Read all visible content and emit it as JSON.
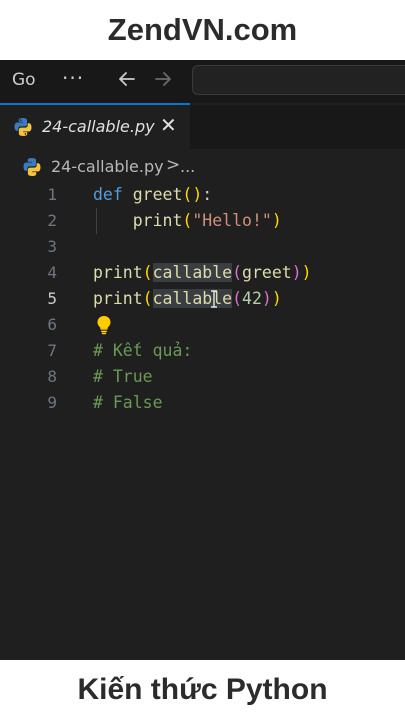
{
  "banner": {
    "top_text": "ZendVN.com",
    "bottom_text": "Kiến thức Python"
  },
  "titlebar": {
    "menu_go": "Go",
    "more": "···",
    "back_icon": "arrow-left-icon",
    "forward_icon": "arrow-right-icon"
  },
  "tab": {
    "label": "24-callable.py",
    "close": "✕",
    "icon": "python-icon"
  },
  "breadcrumb": {
    "file": "24-callable.py",
    "separator": ">",
    "more": "..."
  },
  "editor": {
    "active_line": 5,
    "line_numbers": [
      "1",
      "2",
      "3",
      "4",
      "5",
      "6",
      "7",
      "8",
      "9"
    ],
    "lines": {
      "l1": {
        "kw": "def",
        "fn": "greet",
        "open": "(",
        "close": ")",
        "colon": ":"
      },
      "l2": {
        "fn": "print",
        "open": "(",
        "str": "\"Hello!\"",
        "close": ")"
      },
      "l4": {
        "fn": "print",
        "open": "(",
        "fn2": "callable",
        "open2": "(",
        "arg": "greet",
        "close2": ")",
        "close": ")"
      },
      "l5": {
        "fn": "print",
        "open": "(",
        "fn2": "callable",
        "open2": "(",
        "num": "42",
        "close2": ")",
        "close": ")"
      },
      "l7": "# Kết quả:",
      "l8": "# True",
      "l9": "# False"
    }
  },
  "colors": {
    "background": "#1f1f1f",
    "keyword": "#569cd6",
    "function": "#dcdcaa",
    "string": "#ce9178",
    "number": "#b5cea8",
    "comment": "#6a9955",
    "bracket_1": "#ffd700",
    "bracket_2": "#da70d6",
    "accent": "#0078d4"
  }
}
